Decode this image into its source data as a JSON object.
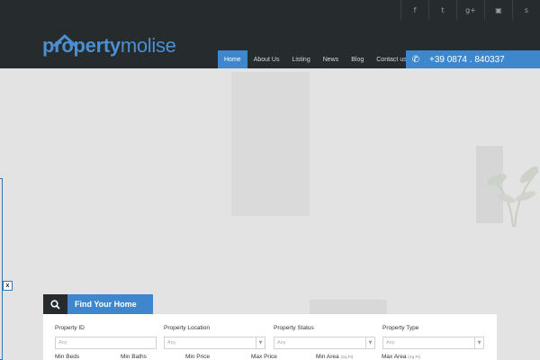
{
  "social": [
    {
      "icon": "facebook-icon",
      "glyph": "f"
    },
    {
      "icon": "twitter-icon",
      "glyph": "t"
    },
    {
      "icon": "google-plus-icon",
      "glyph": "g+"
    },
    {
      "icon": "youtube-icon",
      "glyph": "▣"
    },
    {
      "icon": "skype-icon",
      "glyph": "s"
    }
  ],
  "logo": {
    "part1": "property",
    "part2": "molise"
  },
  "nav": [
    {
      "label": "Home",
      "active": true
    },
    {
      "label": "About Us",
      "active": false
    },
    {
      "label": "Listing",
      "active": false
    },
    {
      "label": "News",
      "active": false
    },
    {
      "label": "Blog",
      "active": false
    },
    {
      "label": "Contact us",
      "active": false
    }
  ],
  "phone": {
    "number": "+39 0874 . 840337",
    "icon": "phone-icon"
  },
  "close_label": "x",
  "search": {
    "title": "Find Your Home",
    "fields": [
      {
        "label": "Property ID",
        "placeholder": "Any",
        "type": "input"
      },
      {
        "label": "Property Location",
        "placeholder": "Any",
        "type": "select"
      },
      {
        "label": "Property Status",
        "placeholder": "Any",
        "type": "select"
      },
      {
        "label": "Property Type",
        "placeholder": "Any",
        "type": "select"
      }
    ],
    "row2": [
      {
        "label": "Min Beds",
        "unit": ""
      },
      {
        "label": "Min Baths",
        "unit": ""
      },
      {
        "label": "Min Price",
        "unit": ""
      },
      {
        "label": "Max Price",
        "unit": ""
      },
      {
        "label": "Min Area",
        "unit": "(Sq Ft)"
      },
      {
        "label": "Max Area",
        "unit": "(Sq Ft)"
      }
    ]
  },
  "colors": {
    "header": "#262b2d",
    "accent": "#3f87cc",
    "logo": "#4b8fd1"
  }
}
